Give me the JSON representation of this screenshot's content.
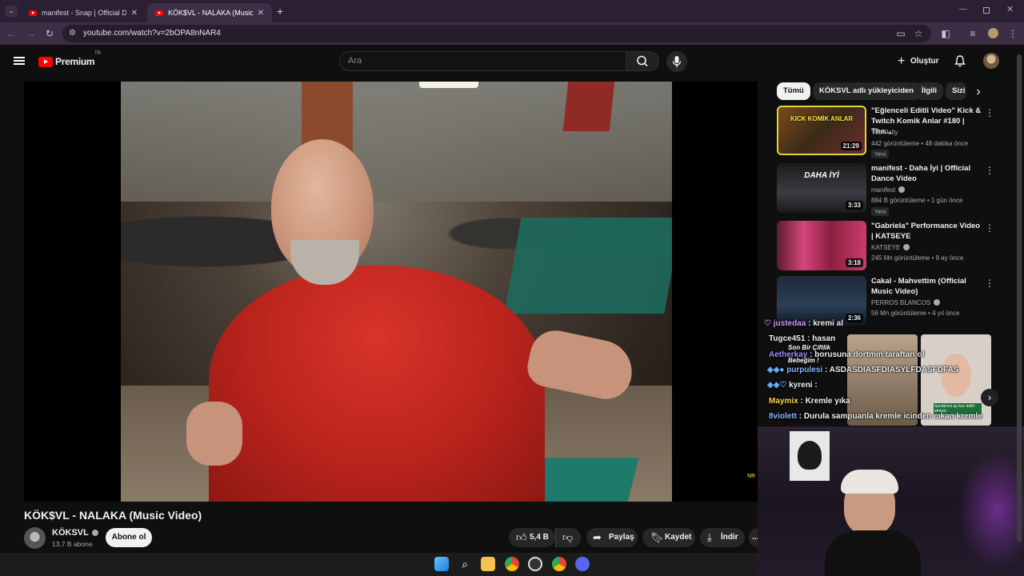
{
  "browser": {
    "tabs": [
      {
        "title": "manifest - Snap | Official Dance",
        "active": false
      },
      {
        "title": "KÖK$VL - NALAKA (Music Video",
        "active": true
      }
    ],
    "url": "youtube.com/watch?v=2bOPA8nNAR4"
  },
  "header": {
    "logo_text": "Premium",
    "region": "TR",
    "search_placeholder": "Ara",
    "create_label": "Oluştur"
  },
  "video": {
    "title": "KÖK$VL - NALAKA (Music Video)",
    "channel": "KÖKSVL",
    "subscribers": "13,7 B abone",
    "subscribe_label": "Abone ol",
    "likes": "5,4 B",
    "share_label": "Paylaş",
    "save_label": "Kaydet",
    "download_label": "İndir",
    "more_label": "..."
  },
  "chips": [
    "Tümü",
    "KÖKSVL adlı yükleyiciden",
    "İlgili",
    "Sizi"
  ],
  "recommended": [
    {
      "title": "\"Eğlenceli Editli Video\" Kick & Twitch Komik Anlar #180 | The...",
      "channel": "The Pally",
      "meta": "442 görüntüleme • 48 dakika önce",
      "badge": "Yeni",
      "duration": "21:29",
      "thumb_text": "KICK KOMİK ANLAR",
      "verified": false
    },
    {
      "title": "manifest - Daha İyi | Official Dance Video",
      "channel": "manifest",
      "meta": "884 B görüntüleme • 1 gün önce",
      "badge": "Yeni",
      "duration": "3:33",
      "thumb_text": "DAHA İYİ",
      "verified": true
    },
    {
      "title": "\"Gabriela\" Performance Video | KATSEYE",
      "channel": "KATSEYE",
      "meta": "245 Mn görüntüleme • 9 ay önce",
      "badge": "",
      "duration": "3:18",
      "thumb_text": "",
      "verified": true
    },
    {
      "title": "Cakal - Mahvettim (Official Music Video)",
      "channel": "PERROS BLANCOS",
      "meta": "56 Mn görüntüleme • 4 yıl önce",
      "badge": "",
      "duration": "2:36",
      "thumb_text": "",
      "verified": true
    }
  ],
  "overlay": {
    "chat": [
      {
        "user": "justedaa",
        "msg": ": kremi al",
        "color": "#d98cff"
      },
      {
        "user": "Tugce451",
        "msg": ": hasan",
        "color": "#ffffff"
      },
      {
        "user": "Aetherkay",
        "msg": ": borusuna dortmin taraftarı ol",
        "color": "#9b8cff"
      },
      {
        "user": "purpulesi",
        "msg": ": ASDASDIASFDIASYLFDASFDFAS",
        "color": "#8ab4ff"
      },
      {
        "user": "kyreni",
        "msg": ":",
        "color": "#ffffff"
      },
      {
        "user": "Maymix",
        "msg": ": Kremle yıka",
        "color": "#ffd35a"
      },
      {
        "user": "8violett",
        "msg": ": Durula sampuanla kremle icinden cıkan kremle",
        "color": "#8ab4ff"
      }
    ],
    "thumb_caption_top": "Son Bir Çiftlik",
    "thumb_caption_2": "Bebeğim !",
    "thumb_caption_3": "Sunda'nın şu kızı teklif etmesi"
  },
  "colors": {
    "bg": "#0f0f0f",
    "browser_frame": "#2b1f33",
    "youtube_red": "#ff0000"
  },
  "icons": [
    "menu-icon",
    "search-icon",
    "mic-icon",
    "plus-icon",
    "bell-icon",
    "like-icon",
    "dislike-icon",
    "share-icon",
    "save-icon",
    "download-icon",
    "kebab-icon",
    "chevron-right-icon"
  ]
}
